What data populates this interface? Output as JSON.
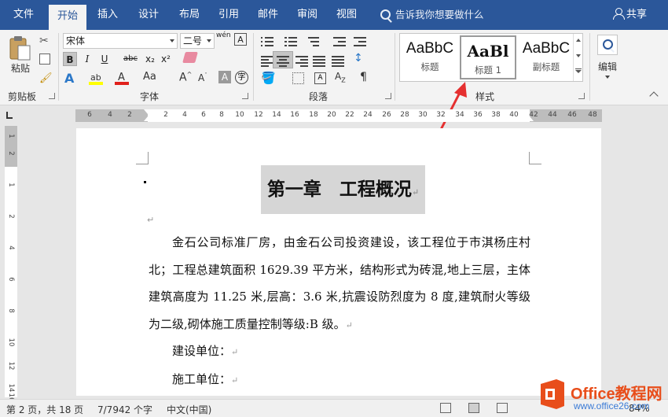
{
  "tabs": [
    "文件",
    "开始",
    "插入",
    "设计",
    "布局",
    "引用",
    "邮件",
    "审阅",
    "视图"
  ],
  "active_tab": "开始",
  "search_placeholder": "告诉我你想要做什么",
  "share_label": "共享",
  "clipboard": {
    "paste_label": "粘贴",
    "group_label": "剪贴板"
  },
  "font": {
    "name": "宋体",
    "size": "二号",
    "wen_label": "wén",
    "group_label": "字体",
    "buttons": [
      "B",
      "I",
      "U",
      "abc",
      "x₂",
      "x²"
    ]
  },
  "paragraph": {
    "group_label": "段落"
  },
  "styles": {
    "items": [
      {
        "sample": "AaBbC",
        "name": "标题"
      },
      {
        "sample": "AaBl",
        "name": "标题 1"
      },
      {
        "sample": "AaBbC",
        "name": "副标题"
      }
    ],
    "selected": "标题 1",
    "group_label": "样式"
  },
  "editing": {
    "label": "编辑"
  },
  "ruler": {
    "h_ticks": [
      "6",
      "4",
      "2",
      "2",
      "4",
      "6",
      "8",
      "10",
      "12",
      "14",
      "16",
      "18",
      "20",
      "22",
      "24",
      "26",
      "28",
      "30",
      "32",
      "34",
      "36",
      "38",
      "40",
      "42",
      "44",
      "46",
      "48"
    ],
    "v_ticks": [
      "1",
      "2",
      "1",
      "2",
      "4",
      "6",
      "8",
      "10",
      "12",
      "14",
      "16"
    ]
  },
  "document": {
    "heading": "第一章　工程概况",
    "paragraph": "金石公司标准厂房，由金石公司投资建设，该工程位于市淇杨庄村北；工程总建筑面积 1629.39 平方米，结构形式为砖混,地上三层，主体建筑高度为 11.25 米,层高：3.6 米,抗震设防烈度为 8 度,建筑耐火等级为二级,砌体施工质量控制等级:B 级。",
    "lines": [
      "建设单位：",
      "施工单位："
    ]
  },
  "status": {
    "page": "第 2 页，共 18 页",
    "words": "7/7942 个字",
    "language": "中文(中国)",
    "zoom": "84%"
  },
  "watermark": {
    "brand": "Office教程网",
    "url": "www.office26.com"
  }
}
